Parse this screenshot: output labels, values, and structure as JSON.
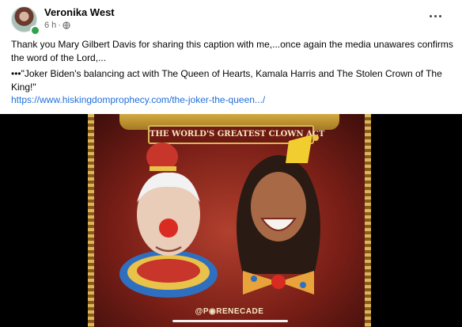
{
  "post": {
    "author": {
      "name": "Veronika West",
      "avatar_icon": "profile-photo",
      "online": true,
      "online_color": "#31a24c"
    },
    "timestamp": "6 h",
    "separator": "·",
    "audience_icon": "globe-icon",
    "more_icon": "more-options-icon",
    "body": {
      "paragraph1": "Thank you Mary Gilbert Davis for sharing this caption with me,...once again the media unawares confirms the word of the Lord,...",
      "paragraph2": "•••\"Joker Biden's balancing act with The Queen of Hearts, Kamala Harris and The Stolen Crown of The King!\"",
      "link_text": "https://www.hiskingdomprophecy.com/the-joker-the-queen.../"
    },
    "media": {
      "type": "video",
      "poster_subtitle": "THE WORLD'S GREATEST CLOWN ACT",
      "poster_credit": "@P◉RENECADE"
    },
    "colors": {
      "link": "#216fdb",
      "text": "#050505",
      "muted": "#65676b",
      "media_bg": "#000000"
    }
  }
}
